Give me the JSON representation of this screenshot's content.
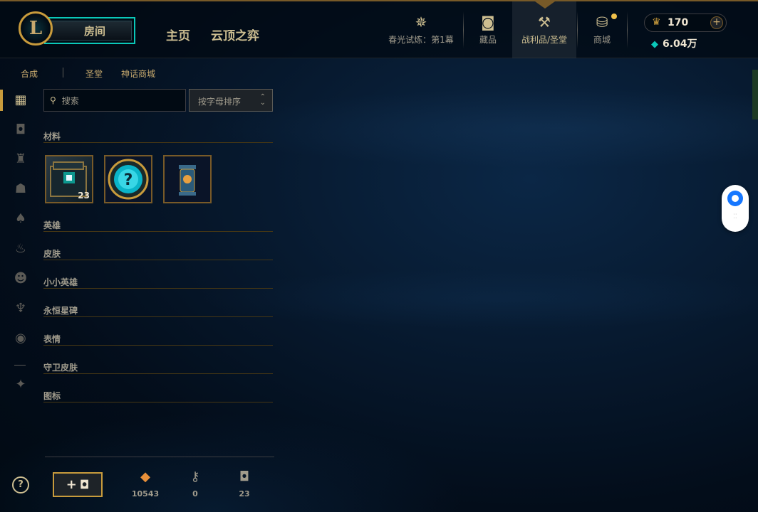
{
  "header": {
    "play_label": "房间",
    "nav_home": "主页",
    "nav_tft": "云顶之弈",
    "nav_items": [
      {
        "label": "春光试炼：第1幕",
        "icon": "event-pass-icon"
      },
      {
        "label": "藏品",
        "icon": "collection-icon"
      },
      {
        "label": "战利品/圣堂",
        "icon": "loot-icon"
      },
      {
        "label": "商城",
        "icon": "store-icon"
      }
    ],
    "rp_amount": "170",
    "be_amount": "6.04万"
  },
  "subnav": {
    "tabs": [
      "合成",
      "圣堂",
      "神话商城"
    ],
    "active": "合成"
  },
  "filters": {
    "search_placeholder": "搜索",
    "sort_label": "按字母排序"
  },
  "sidebar_icons": [
    "all-icon",
    "chest-icon",
    "champion-icon",
    "skin-icon",
    "ward-icon",
    "emote-flame-icon",
    "emote-icon",
    "little-legend-icon",
    "profile-icon",
    "emblem-icon"
  ],
  "categories": [
    "材料",
    "英雄",
    "皮肤",
    "小小英雄",
    "永恒星碑",
    "表情",
    "守卫皮肤",
    "图标"
  ],
  "materials": [
    {
      "name": "hextech-chest",
      "count": "23"
    },
    {
      "name": "mystery-orb",
      "count": ""
    },
    {
      "name": "capsule",
      "count": ""
    }
  ],
  "footer": {
    "orange_essence": "10543",
    "keys": "0",
    "chests": "23",
    "add_label": "+"
  },
  "colors": {
    "gold": "#c89b3c",
    "teal": "#0ac8b9",
    "text": "#cdbe91"
  }
}
